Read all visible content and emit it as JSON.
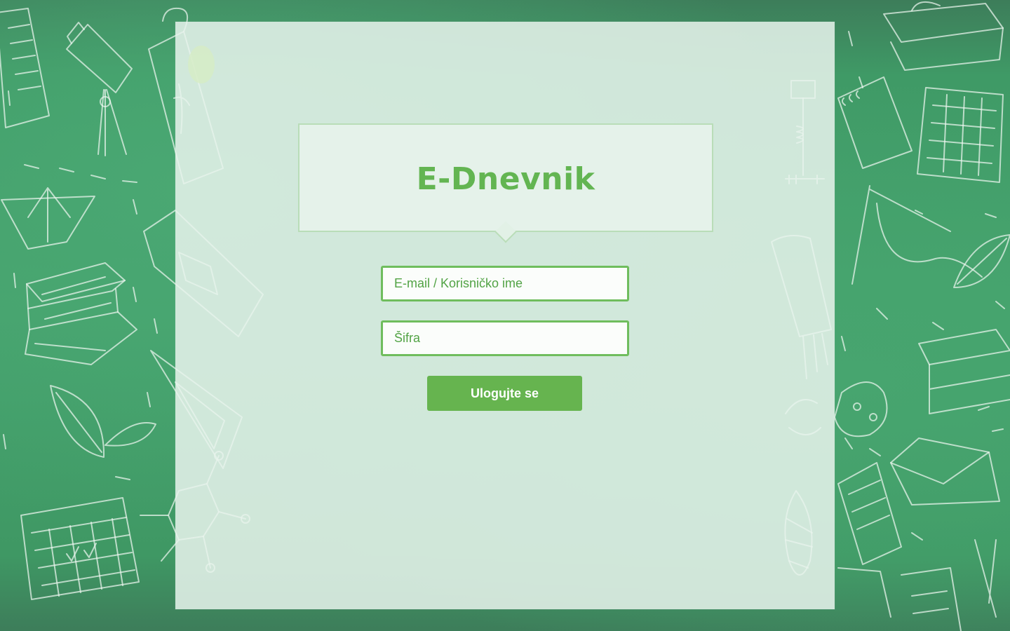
{
  "app": {
    "title": "E-Dnevnik"
  },
  "login_form": {
    "username_placeholder": "E-mail / Korisničko ime",
    "password_placeholder": "Šifra",
    "submit_label": "Ulogujte se"
  },
  "colors": {
    "accent": "#66b44f",
    "title_text": "#63b552",
    "background_chalkboard": "#45a26d"
  },
  "background_icons": [
    "notebook-icon",
    "telescope-icon",
    "bookmark-icon",
    "paper-boat-icon",
    "books-icon",
    "pencil-case-icon",
    "triangle-ruler-icon",
    "leaf-icon",
    "calendar-icon",
    "molecule-icon",
    "scale-icon",
    "bow-icon",
    "spiral-notebook-icon",
    "chart-icon",
    "envelope-icon",
    "microscope-icon",
    "pinecone-icon",
    "brush-icon"
  ]
}
